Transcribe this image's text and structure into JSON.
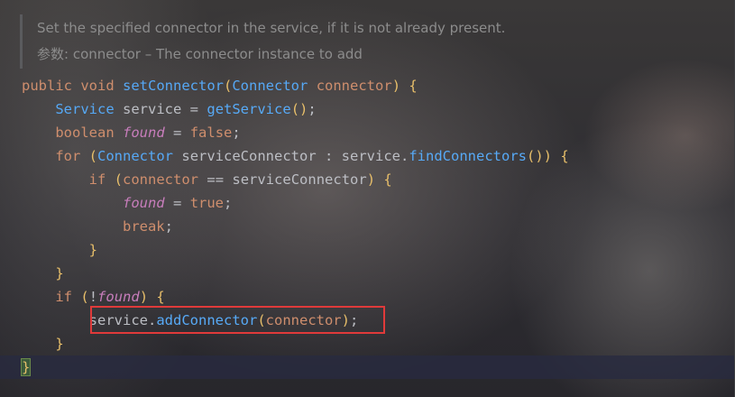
{
  "doc": {
    "line1": "Set the specified connector in the service, if it is not already present.",
    "param_label": "参数:",
    "param_text": " connector – The connector instance to add"
  },
  "code": {
    "public": "public",
    "void": "void",
    "method_name": "setConnector",
    "param_type": "Connector",
    "param_name": "connector",
    "service_type": "Service",
    "service_var": "service",
    "get_service": "getService",
    "boolean": "boolean",
    "found": "found",
    "false": "false",
    "for": "for",
    "sc_var": "serviceConnector",
    "find": "findConnectors",
    "if": "if",
    "true": "true",
    "break": "break",
    "add_connector": "addConnector"
  },
  "colors": {
    "keyword": "#cf8e6d",
    "method": "#56a8f5",
    "field": "#c77dbb",
    "highlight_box": "#e03a3a"
  }
}
